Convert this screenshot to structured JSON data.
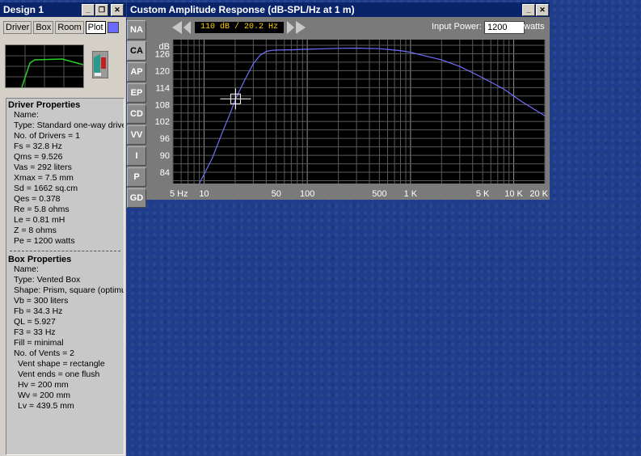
{
  "design": {
    "title": "Design 1",
    "tabs": [
      "Driver",
      "Box",
      "Room",
      "Plot"
    ],
    "driver_properties": {
      "heading": "Driver Properties",
      "lines": [
        "Name:",
        "Type: Standard one-way driver",
        "No. of Drivers = 1",
        "Fs =  32.8 Hz",
        "Qms =  9.526",
        "Vas =  292 liters",
        "Xmax =  7.5 mm",
        "Sd =  1662 sq.cm",
        "Qes =  0.378",
        "Re =  5.8 ohms",
        "Le =  0.81 mH",
        "Z =  8 ohms",
        "Pe =  1200 watts"
      ]
    },
    "box_properties": {
      "heading": "Box Properties",
      "lines": [
        "Name:",
        "Type: Vented Box",
        "Shape: Prism, square (optimum)",
        "Vb =  300 liters",
        "Fb =  34.3 Hz",
        "QL =  5.927",
        "F3 =  33 Hz",
        "Fill = minimal",
        "No. of Vents = 2"
      ],
      "sub_lines": [
        "Vent shape = rectangle",
        "Vent ends = one flush"
      ],
      "dim_lines": [
        "Hv =  200 mm",
        "Wv =  200 mm",
        "Lv =  439.5 mm"
      ]
    }
  },
  "response": {
    "title": "Custom Amplitude Response (dB-SPL/Hz at 1 m)",
    "side_tabs": [
      "NA",
      "CA",
      "AP",
      "EP",
      "CD",
      "VV",
      "I",
      "P",
      "GD"
    ],
    "active_tab": "CA",
    "cursor_readout": "110 dB / 20.2 Hz",
    "input_power_label": "Input Power:",
    "input_power_value": "1200",
    "input_power_unit": "watts"
  },
  "chart_data": {
    "type": "line",
    "title": "",
    "xlabel": "",
    "ylabel": "dB",
    "x_scale": "log",
    "xlim": [
      5,
      20000
    ],
    "ylim": [
      80,
      131
    ],
    "yticks": [
      84,
      90,
      96,
      102,
      108,
      114,
      120,
      126
    ],
    "xtick_labels": [
      {
        "v": 5,
        "label": "5 Hz"
      },
      {
        "v": 10,
        "label": "10"
      },
      {
        "v": 50,
        "label": "50"
      },
      {
        "v": 100,
        "label": "100"
      },
      {
        "v": 500,
        "label": "500"
      },
      {
        "v": 1000,
        "label": "1 K"
      },
      {
        "v": 5000,
        "label": "5 K"
      },
      {
        "v": 10000,
        "label": "10 K"
      },
      {
        "v": 20000,
        "label": "20 K"
      }
    ],
    "grid": true,
    "line_color": "#6f6fff",
    "series": [
      {
        "x": [
          9,
          12,
          15,
          18,
          20.2,
          25,
          30,
          35,
          40,
          45,
          50,
          70,
          100,
          200,
          300,
          500,
          800,
          1000,
          2000,
          3000,
          5000,
          8000,
          12000,
          20000
        ],
        "y": [
          79,
          89,
          98,
          105,
          110,
          117,
          122.5,
          125.5,
          126.8,
          127.2,
          127.3,
          127.4,
          127.6,
          127.9,
          128,
          127.8,
          127.1,
          126.5,
          123.8,
          121.5,
          117.5,
          113.5,
          109,
          104
        ]
      }
    ],
    "cursor": {
      "x": 20.2,
      "y": 110
    }
  }
}
